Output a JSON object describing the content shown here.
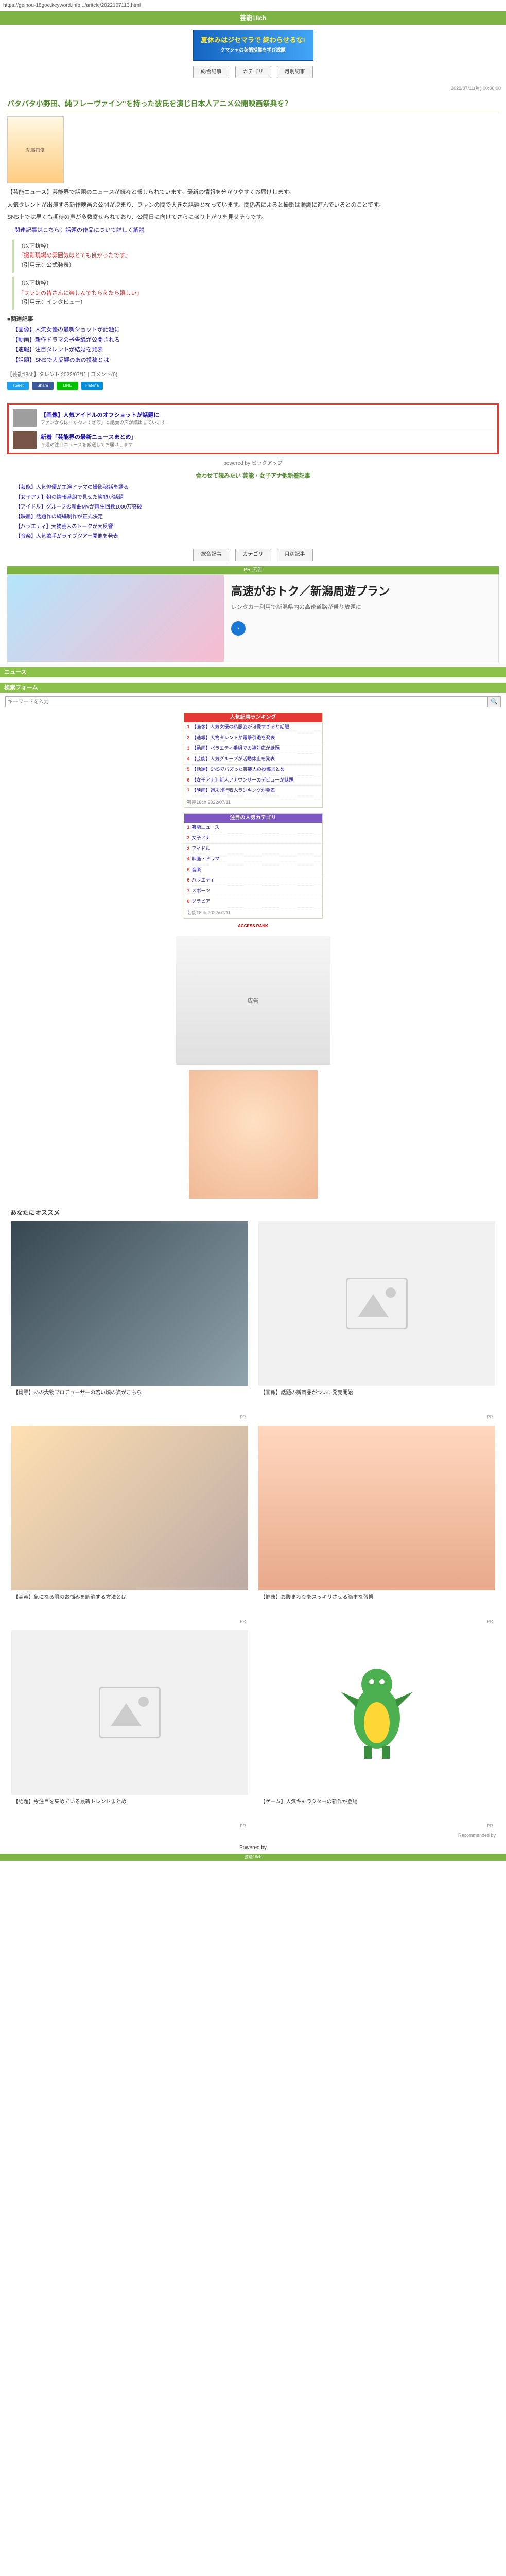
{
  "url": "https://geinou-18goe.keyword.info.../aritcle/2022107113.html",
  "site_title": "芸能18ch",
  "top_banner": {
    "headline": "夏休みはジセマラで 終わらせるな!",
    "sub": "クマシャの英語授業を学び放題"
  },
  "nav": [
    "総合記事",
    "カテゴリ",
    "月別記事"
  ],
  "small_right": "2022/07/11(月) 00:00:00",
  "article": {
    "title": "パタパタ小野田、純フレーヴァイン\"を持った彼氏を演じ日本人アニメ公開映画祭典を？",
    "img_alt": "記事画像",
    "paras": [
      "【芸能ニュース】芸能界で話題のニュースが続々と報じられています。最新の情報を分かりやすくお届けします。",
      "人気タレントが出演する新作映画の公開が決まり、ファンの間で大きな話題となっています。関係者によると撮影は順調に進んでいるとのことです。",
      "SNS上では早くも期待の声が多数寄せられており、公開日に向けてさらに盛り上がりを見せそうです。"
    ],
    "link_para": "→ 関連記事はこちら：話題の作品について詳しく解説",
    "quote1": {
      "label": "（以下抜粋）",
      "red": "「撮影現場の雰囲気はとても良かったです」",
      "src": "（引用元：公式発表）"
    },
    "quote2": {
      "label": "（以下抜粋）",
      "red": "「ファンの皆さんに楽しんでもらえたら嬉しい」",
      "src": "（引用元：インタビュー）"
    },
    "sub_heading": "■関連記事",
    "list": [
      "【画像】人気女優の最新ショットが話題に",
      "【動画】新作ドラマの予告編が公開される",
      "【速報】注目タレントが結婚を発表",
      "【話題】SNSで大反響のあの投稿とは"
    ],
    "meta": "【芸能18ch】タレント 2022/07/11 | コメント(0)",
    "share": [
      "Tweet",
      "Share",
      "LINE",
      "Hatena"
    ]
  },
  "related": [
    {
      "title": "【画像】人気アイドルのオフショットが話題に",
      "sub": "ファンからは「かわいすぎる」と絶賛の声が続出しています"
    },
    {
      "title": "新着「芸能界の最新ニュースまとめ」",
      "sub": "今週の注目ニュースを厳選してお届けします"
    }
  ],
  "related_note": "powered by ピックアップ",
  "more_links": {
    "heading": "合わせて読みたい 芸能・女子アナ他新着記事",
    "items": [
      "【芸能】人気俳優が主演ドラマの撮影秘話を語る",
      "【女子アナ】朝の情報番組で見せた笑顔が話題",
      "【アイドル】グループの新曲MVが再生回数1000万突破",
      "【映画】話題作の続編制作が正式決定",
      "【バラエティ】大物芸人のトークが大反響",
      "【音楽】人気歌手がライブツアー開催を発表"
    ]
  },
  "ad_wide": {
    "label": "PR 広告",
    "big": "高速がおトク／新潟周遊プラン",
    "sm": "レンタカー利用で新潟県内の高速道路が乗り放題に"
  },
  "sections": {
    "a": "ニュース",
    "b": "検索フォーム"
  },
  "search": {
    "placeholder": "キーワードを入力",
    "button": "🔍"
  },
  "rank1": {
    "head": "人気記事ランキング",
    "items": [
      "【画像】人気女優の私服姿が可愛すぎると話題",
      "【速報】大物タレントが電撃引退を発表",
      "【動画】バラエティ番組での神対応が話題",
      "【芸能】人気グループが活動休止を発表",
      "【話題】SNSでバズった芸能人の投稿まとめ",
      "【女子アナ】新人アナウンサーのデビューが話題",
      "【映画】週末興行収入ランキングが発表"
    ],
    "foot": "芸能18ch 2022/07/11"
  },
  "rank2": {
    "head": "注目の人気カテゴリ",
    "items": [
      "芸能ニュース",
      "女子アナ",
      "アイドル",
      "映画・ドラマ",
      "音楽",
      "バラエティ",
      "スポーツ",
      "グラビア"
    ],
    "foot": "芸能18ch 2022/07/11"
  },
  "logo_mini": "ACCESS RANK",
  "ad_square": "広告",
  "rec": {
    "heading": "あなたにオススメ",
    "items": [
      "【衝撃】あの大物プロデューサーの若い頃の姿がこちら",
      "【画像】話題の新商品がついに発売開始",
      "【美容】気になる肌のお悩みを解消する方法とは",
      "【健康】お腹まわりをスッキリさせる簡単な習慣",
      "【話題】今注目を集めている最新トレンドまとめ",
      "【ゲーム】人気キャラクターの新作が登場"
    ],
    "pr": "PR"
  },
  "footer_note": "Recommended by",
  "footer_logo": "Powered by"
}
